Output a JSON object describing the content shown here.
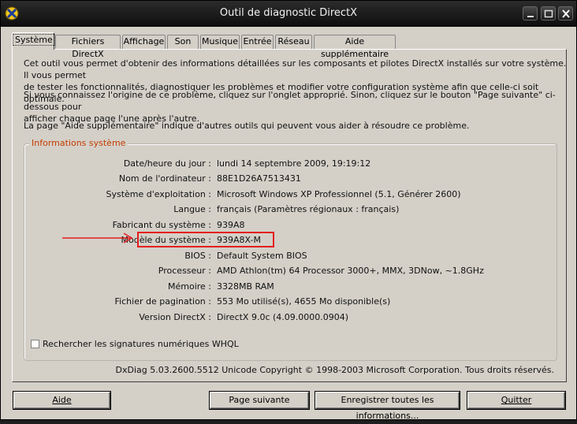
{
  "window": {
    "title": "Outil de diagnostic DirectX"
  },
  "tabs": [
    {
      "label": "Système",
      "active": true
    },
    {
      "label": "Fichiers DirectX"
    },
    {
      "label": "Affichage"
    },
    {
      "label": "Son"
    },
    {
      "label": "Musique"
    },
    {
      "label": "Entrée"
    },
    {
      "label": "Réseau"
    },
    {
      "label": "Aide supplémentaire"
    }
  ],
  "intro": {
    "p1_line1": "Cet outil vous permet d'obtenir des informations détaillées sur les composants et pilotes DirectX installés sur votre système. Il vous permet",
    "p1_line2": "de tester les fonctionnalités, diagnostiquer les problèmes et modifier votre configuration système afin que celle-ci soit optimale.",
    "p2_line1": "Si vous connaissez l'origine de ce problème, cliquez sur l'onglet approprié. Sinon, cliquez sur le bouton \"Page suivante\" ci-dessous pour",
    "p2_line2": "afficher chaque page l'une après l'autre.",
    "p3": "La page \"Aide supplémentaire\" indique d'autres outils qui peuvent vous aider à résoudre ce problème."
  },
  "system_info": {
    "group_title": "Informations système",
    "rows": [
      {
        "label": "Date/heure du jour :",
        "value": "lundi 14 septembre 2009, 19:19:12"
      },
      {
        "label": "Nom de l'ordinateur :",
        "value": "88E1D26A7513431"
      },
      {
        "label": "Système d'exploitation :",
        "value": "Microsoft Windows XP Professionnel (5.1, Générer 2600)"
      },
      {
        "label": "Langue :",
        "value": "français (Paramètres régionaux : français)"
      },
      {
        "label": "Fabricant du système :",
        "value": "939A8"
      },
      {
        "label": "Modèle du système :",
        "value": "939A8X-M"
      },
      {
        "label": "BIOS :",
        "value": "Default System BIOS"
      },
      {
        "label": "Processeur :",
        "value": "AMD Athlon(tm) 64 Processor 3000+,  MMX,  3DNow, ~1.8GHz"
      },
      {
        "label": "Mémoire :",
        "value": "3328MB RAM"
      },
      {
        "label": "Fichier de pagination :",
        "value": "553 Mo utilisé(s), 4655 Mo disponible(s)"
      },
      {
        "label": "Version DirectX :",
        "value": "DirectX 9.0c (4.09.0000.0904)"
      }
    ]
  },
  "whql_checkbox": {
    "label": "Rechercher les signatures numériques WHQL",
    "checked": false
  },
  "footer": "DxDiag 5.03.2600.5512 Unicode  Copyright © 1998-2003 Microsoft Corporation. Tous droits réservés.",
  "buttons": {
    "help": "Aide",
    "next": "Page suivante",
    "save": "Enregistrer toutes les informations...",
    "quit": "Quitter"
  },
  "colors": {
    "annotation": "#e41e1e",
    "group_title": "#c43c00"
  }
}
